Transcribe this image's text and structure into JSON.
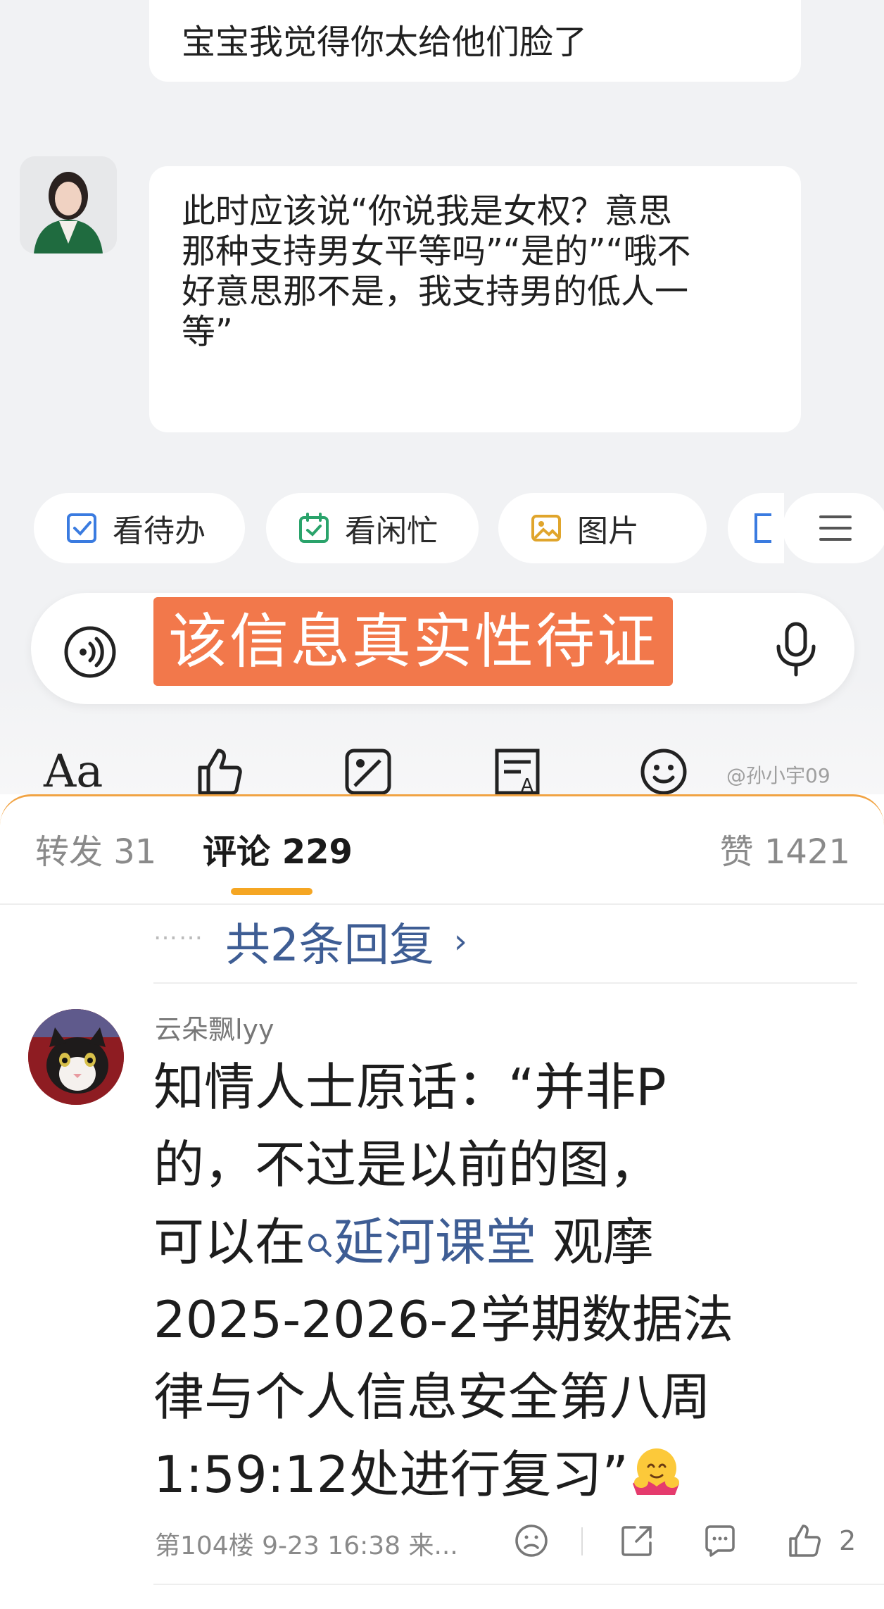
{
  "chat": {
    "bubble_top": "宝宝我觉得你太给他们脸了",
    "bubble_main_lines": [
      "此时应该说“你说我是女权？意思",
      "那种支持男女平等吗”“是的”“哦不",
      "好意思那不是，我支持男的低人一",
      "等”"
    ]
  },
  "chips": {
    "todo": "看待办",
    "busy": "看闲忙",
    "pic": "图片"
  },
  "warning": "该信息真实性待证",
  "toolbar": {
    "font_label": "Aa"
  },
  "watermark": "@孙小宇09",
  "tabs": {
    "repost": "转发 31",
    "comment": "评论 229",
    "like": "赞 1421"
  },
  "replies": {
    "dots": "……",
    "text": "共2条回复",
    "arrow": "›"
  },
  "comment": {
    "user": "云朵飘lyy",
    "line1": "知情人士原话：“并非P",
    "line2": "的，不过是以前的图，",
    "line3_pre": "可以在",
    "link": "延河课堂",
    "line3_post": " 观摩",
    "line4": "2025-2026-2学期数据法",
    "line5": "律与个人信息安全第八周",
    "line6": "1:59:12处进行复习”",
    "meta": "第104楼 9-23 16:38 来...",
    "like_count": "2"
  },
  "colors": {
    "accent": "#f5a623",
    "link": "#3e5d94",
    "warning_bg": "#f2784b"
  },
  "icons": [
    "checkbox-icon",
    "calendar-check-icon",
    "image-icon",
    "menu-icon",
    "voice-icon",
    "mic-icon",
    "thumb-up-icon",
    "edit-image-icon",
    "text-scan-icon",
    "emoji-icon",
    "search-icon",
    "dislike-face-icon",
    "share-icon",
    "comment-icon"
  ]
}
